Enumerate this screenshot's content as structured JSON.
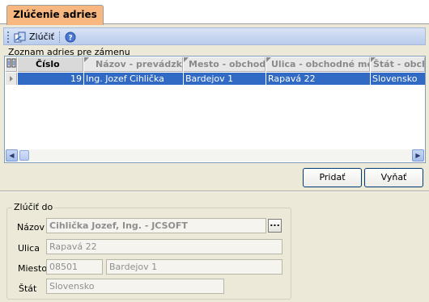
{
  "tab": {
    "label": "Zlúčenie adries"
  },
  "toolbar": {
    "merge_label": "Zlúčiť"
  },
  "list_group": {
    "label": "Zoznam adries pre zámenu"
  },
  "grid": {
    "columns": [
      "Číslo",
      "Názov - prevádzka",
      "Mesto - obchodné",
      "Ulica - obchodné meno",
      "Štát - obchod"
    ],
    "rows": [
      {
        "cislo": "19",
        "nazov": "Ing. Jozef Cihlička",
        "mesto": "Bardejov 1",
        "ulica": "Rapavá 22",
        "stat": "Slovensko"
      }
    ]
  },
  "buttons": {
    "add_label": "Pridať",
    "remove_label": "Vyňať"
  },
  "merge_to": {
    "legend": "Zlúčiť do",
    "name_label": "Názov",
    "name_value": "Cihlička Jozef, Ing. - JCSOFT",
    "browse_label": "...",
    "street_label": "Ulica",
    "street_value": "Rapavá 22",
    "city_label": "Miesto",
    "zip_value": "08501",
    "city_value": "Bardejov 1",
    "country_label": "Štát",
    "country_value": "Slovensko"
  },
  "colors": {
    "selection": "#316ac5",
    "tab": "#f7b77e",
    "window": "#ece9d8"
  }
}
